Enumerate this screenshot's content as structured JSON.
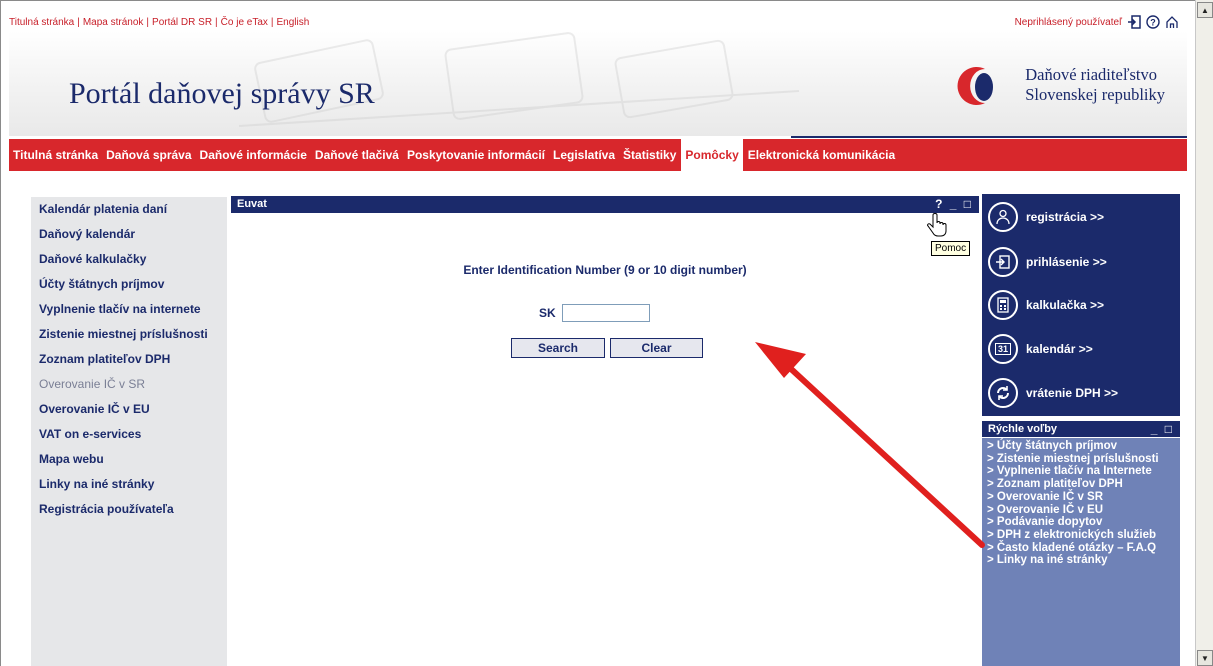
{
  "top_links": [
    "Titulná stránka",
    "Mapa stránok",
    "Portál DR SR",
    "Čo je eTax",
    "English"
  ],
  "user": {
    "label": "Neprihlásený používateľ"
  },
  "header": {
    "portal_title": "Portál daňovej správy SR",
    "org_line1": "Daňové riaditeľstvo",
    "org_line2": "Slovenskej republiky"
  },
  "nav": {
    "items": [
      "Titulná stránka",
      "Daňová správa",
      "Daňové informácie",
      "Daňové tlačivá",
      "Poskytovanie informácií",
      "Legislatíva",
      "Štatistiky",
      "Pomôcky",
      "Elektronická komunikácia"
    ],
    "active": "Pomôcky"
  },
  "sidebar": {
    "items": [
      "Kalendár platenia daní",
      "Daňový kalendár",
      "Daňové kalkulačky",
      "Účty štátnych príjmov",
      "Vyplnenie tlačív na internete",
      "Zistenie miestnej príslušnosti",
      "Zoznam platiteľov DPH",
      "Overovanie IČ v SR",
      "Overovanie IČ v EU",
      "VAT on e-services",
      "Mapa webu",
      "Linky na iné stránky",
      "Registrácia používateľa"
    ],
    "muted_index": 7
  },
  "panel": {
    "title": "Euvat",
    "controls": "? _ □",
    "tooltip": "Pomoc",
    "instruction": "Enter Identification Number (9 or 10 digit number)",
    "prefix": "SK",
    "input_value": "",
    "search_label": "Search",
    "clear_label": "Clear"
  },
  "right": {
    "buttons": [
      {
        "label": "registrácia >>",
        "icon": "person-icon"
      },
      {
        "label": "prihlásenie >>",
        "icon": "login-icon"
      },
      {
        "label": "kalkulačka >>",
        "icon": "calculator-icon"
      },
      {
        "label": "kalendár >>",
        "icon": "calendar-icon",
        "glyph": "31"
      },
      {
        "label": "vrátenie DPH >>",
        "icon": "refresh-icon"
      }
    ],
    "quick_title": "Rýchle voľby",
    "quick_controls": "_ □",
    "quick_items": [
      "> Účty štátnych príjmov",
      "> Zistenie miestnej príslušnosti",
      "> Vyplnenie tlačív na Internete",
      "> Zoznam platiteľov DPH",
      "> Overovanie IČ v SR",
      "> Overovanie IČ v EU",
      "> Podávanie dopytov",
      "> DPH z elektronických služieb",
      "> Často kladené otázky – F.A.Q",
      "> Linky na iné stránky"
    ]
  },
  "colors": {
    "brand_red": "#d8272c",
    "navy": "#1b2a6b",
    "quick_bg": "#6f82b7",
    "annotation_arrow": "#e0201e"
  }
}
